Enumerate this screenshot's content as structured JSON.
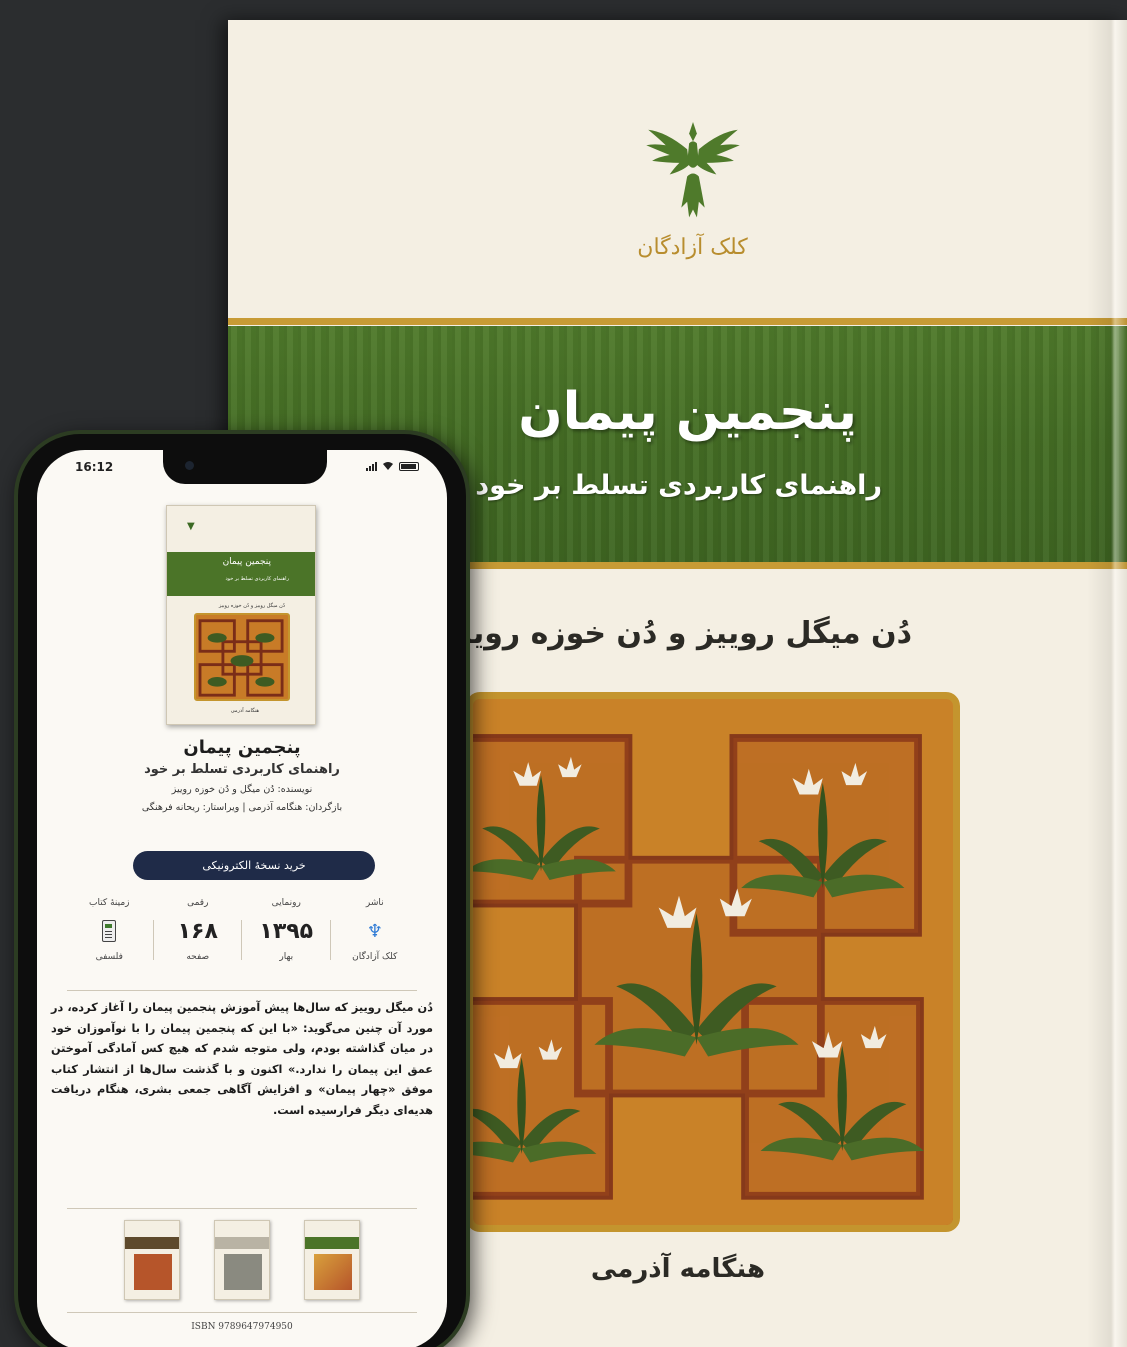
{
  "cover": {
    "publisher": "کلک آزادگان",
    "title": "پنجمین پیمان",
    "subtitle": "راهنمای کاربردی تسلط بر خود",
    "authors": "دُن میگل روییز و دُن خوزه روییز",
    "translator": "هنگامه آذرمی",
    "colors": {
      "band": "#446d24",
      "gold": "#c79b35",
      "paper": "#f4efe3"
    },
    "logo_icon": "eagle-logo-icon"
  },
  "phone": {
    "status": {
      "time": "16:12",
      "icons": [
        "signal-icon",
        "wifi-icon",
        "battery-icon"
      ]
    },
    "thumbnail": {
      "title": "پنجمین پیمان",
      "subtitle": "راهنمای کاربردی تسلط بر خود",
      "authors": "دُن میگل روییز و دُن خوزه روییز",
      "translator": "هنگامه آذرمی"
    },
    "book": {
      "title": "پنجمین پیمان",
      "subtitle": "راهنمای کاربردی تسلط بر خود",
      "author_line": "نویسنده: دُن میگل و دُن خوزه روییز",
      "credits_line": "بازگردان: هنگامه آذرمی | ویراستار: ریحانه فرهنگی"
    },
    "buy_button": "خرید نسخهٔ الکترونیکی",
    "meta": [
      {
        "key": "ناشر",
        "value_icon": "publisher-logo-icon",
        "sub": "کلک آزادگان"
      },
      {
        "key": "رونمایی",
        "value": "۱۳۹۵",
        "sub": "بهار"
      },
      {
        "key": "رقمی",
        "value": "۱۶۸",
        "sub": "صفحه"
      },
      {
        "key": "زمینهٔ کتاب",
        "value_icon": "calculator-icon",
        "sub": "فلسفی"
      }
    ],
    "description": "دُن میگل روییز که سال‌ها پیش آموزش پنجمین پیمان را آغاز کرده، در مورد آن چنین می‌گوید: «با این که پنجمین پیمان را با نوآموزان خود در میان گذاشته بودم، ولی متوجه شدم که هیچ کس آمادگی آموختن عمق این پیمان را ندارد.» اکنون و با گذشت سال‌ها از انتشار کتاب موفق «چهار پیمان» و افزایش آگاهی جمعی بشری، هنگام دریافت هدیه‌ای دیگر فرارسیده است.",
    "related_books": [
      {
        "band": "#4b7428",
        "art": "#d9a03c"
      },
      {
        "band": "#b9b3a4",
        "art": "#8a8a80"
      },
      {
        "band": "#5e4a2c",
        "art": "#b6552a"
      }
    ],
    "isbn": "ISBN 9789647974950"
  }
}
